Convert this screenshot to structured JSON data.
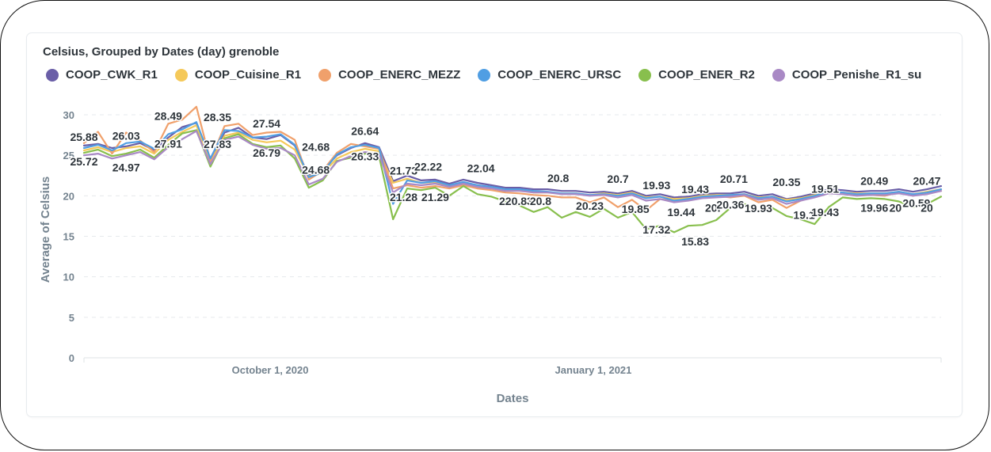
{
  "chart_data": {
    "type": "line",
    "title": "Celsius, Grouped by Dates (day) grenoble",
    "xlabel": "Dates",
    "ylabel": "Average of Celsius",
    "ylim": [
      0,
      30
    ],
    "yticks": [
      "0",
      "5",
      "10",
      "15",
      "20",
      "25",
      "30"
    ],
    "xticks": [
      {
        "date": "2020-10-01",
        "label": "October 1, 2020"
      },
      {
        "date": "2021-01-01",
        "label": "January 1, 2021"
      }
    ],
    "x_range": [
      "2020-08-09",
      "2021-04-10"
    ],
    "grid": true,
    "legend_position": "top-left",
    "x_dates": [
      "2020-08-09",
      "2020-08-13",
      "2020-08-17",
      "2020-08-21",
      "2020-08-25",
      "2020-08-29",
      "2020-09-02",
      "2020-09-06",
      "2020-09-10",
      "2020-09-14",
      "2020-09-18",
      "2020-09-22",
      "2020-09-26",
      "2020-09-30",
      "2020-10-04",
      "2020-10-08",
      "2020-10-12",
      "2020-10-16",
      "2020-10-20",
      "2020-10-24",
      "2020-10-28",
      "2020-11-01",
      "2020-11-05",
      "2020-11-09",
      "2020-11-13",
      "2020-11-17",
      "2020-11-21",
      "2020-11-25",
      "2020-11-29",
      "2020-12-03",
      "2020-12-07",
      "2020-12-11",
      "2020-12-15",
      "2020-12-19",
      "2020-12-23",
      "2020-12-27",
      "2020-12-31",
      "2021-01-04",
      "2021-01-08",
      "2021-01-12",
      "2021-01-16",
      "2021-01-20",
      "2021-01-24",
      "2021-01-28",
      "2021-02-01",
      "2021-02-05",
      "2021-02-09",
      "2021-02-13",
      "2021-02-17",
      "2021-02-21",
      "2021-02-25",
      "2021-03-01",
      "2021-03-05",
      "2021-03-09",
      "2021-03-13",
      "2021-03-17",
      "2021-03-21",
      "2021-03-25",
      "2021-03-29",
      "2021-04-02",
      "2021-04-06",
      "2021-04-10"
    ],
    "series": [
      {
        "name": "COOP_CWK_R1",
        "color": "#6a5ea7",
        "values": [
          26.2,
          26.4,
          25.9,
          26.1,
          26.5,
          25.6,
          27.2,
          28.5,
          29.0,
          24.5,
          27.8,
          28.4,
          27.2,
          27.0,
          27.5,
          26.2,
          22.5,
          23.2,
          25.0,
          25.9,
          26.5,
          26.0,
          21.8,
          22.5,
          21.9,
          22.0,
          21.5,
          22.0,
          21.6,
          21.3,
          21.0,
          21.0,
          20.8,
          20.8,
          20.6,
          20.6,
          20.4,
          20.5,
          20.3,
          20.6,
          20.0,
          20.2,
          19.8,
          19.9,
          20.2,
          20.3,
          20.3,
          20.5,
          20.0,
          20.2,
          19.6,
          19.9,
          20.3,
          20.8,
          20.7,
          20.5,
          20.6,
          20.6,
          20.8,
          20.5,
          20.8,
          21.2
        ]
      },
      {
        "name": "COOP_Cuisine_R1",
        "color": "#f5c95a",
        "values": [
          25.6,
          26.0,
          25.4,
          25.9,
          26.1,
          25.2,
          26.9,
          27.9,
          28.7,
          24.1,
          27.4,
          27.8,
          26.9,
          26.6,
          26.8,
          25.7,
          22.4,
          22.8,
          24.6,
          25.4,
          25.8,
          25.5,
          21.6,
          22.1,
          21.6,
          21.7,
          21.2,
          21.6,
          21.3,
          21.0,
          20.8,
          20.7,
          20.4,
          20.4,
          20.3,
          20.3,
          20.1,
          20.3,
          20.1,
          20.4,
          19.8,
          19.9,
          19.6,
          19.7,
          20.0,
          20.1,
          20.1,
          20.2,
          19.8,
          19.9,
          19.5,
          19.7,
          20.1,
          20.5,
          20.4,
          20.3,
          20.3,
          20.3,
          20.5,
          20.2,
          20.5,
          20.8
        ]
      },
      {
        "name": "COOP_ENERC_MEZZ",
        "color": "#f0a06b",
        "values": [
          26.5,
          27.9,
          25.2,
          27.8,
          26.8,
          25.4,
          28.9,
          29.4,
          31.0,
          24.3,
          28.6,
          28.9,
          27.5,
          27.8,
          27.9,
          26.9,
          22.0,
          23.1,
          25.3,
          26.4,
          26.1,
          25.8,
          20.9,
          21.3,
          21.0,
          21.2,
          20.9,
          21.3,
          20.9,
          20.7,
          20.4,
          20.3,
          20.1,
          20.0,
          19.8,
          19.8,
          19.2,
          19.8,
          18.6,
          19.5,
          18.2,
          19.6,
          19.3,
          19.5,
          19.9,
          20.0,
          19.8,
          20.0,
          19.2,
          19.5,
          18.5,
          19.4,
          19.9,
          20.6,
          20.4,
          20.1,
          20.1,
          20.0,
          20.4,
          20.0,
          20.3,
          20.6
        ]
      },
      {
        "name": "COOP_ENERC_URSC",
        "color": "#509ee3",
        "values": [
          25.9,
          26.3,
          25.6,
          26.5,
          26.7,
          25.8,
          27.6,
          28.2,
          29.1,
          24.6,
          28.1,
          28.0,
          27.2,
          27.3,
          27.6,
          26.3,
          22.3,
          22.9,
          25.1,
          26.0,
          26.3,
          25.9,
          19.0,
          21.9,
          21.6,
          21.8,
          21.3,
          21.7,
          21.3,
          21.1,
          20.8,
          20.8,
          20.6,
          20.5,
          20.3,
          20.3,
          20.1,
          20.2,
          20.0,
          20.3,
          19.7,
          19.9,
          19.4,
          19.6,
          19.9,
          20.0,
          20.1,
          20.2,
          19.7,
          19.9,
          19.3,
          19.6,
          20.0,
          20.5,
          20.4,
          20.2,
          20.3,
          20.3,
          20.5,
          20.2,
          20.4,
          20.8
        ]
      },
      {
        "name": "COOP_ENER_R2",
        "color": "#88bf4d",
        "values": [
          25.3,
          25.7,
          24.9,
          25.2,
          25.7,
          24.7,
          26.3,
          27.7,
          28.1,
          23.6,
          27.1,
          27.6,
          26.4,
          26.0,
          26.2,
          24.6,
          21.0,
          21.9,
          24.3,
          24.7,
          25.2,
          24.9,
          17.1,
          20.9,
          20.7,
          21.0,
          20.0,
          21.2,
          20.2,
          19.9,
          19.3,
          18.8,
          18.0,
          18.6,
          17.3,
          18.0,
          17.4,
          18.4,
          17.3,
          18.0,
          15.9,
          16.3,
          15.5,
          16.3,
          16.4,
          17.0,
          18.5,
          19.0,
          18.1,
          18.5,
          17.5,
          17.1,
          16.5,
          18.6,
          19.8,
          19.6,
          19.7,
          19.6,
          19.3,
          18.6,
          19.0,
          19.9
        ]
      },
      {
        "name": "COOP_Penishe_R1_su",
        "color": "#a989c5",
        "values": [
          25.0,
          25.2,
          24.6,
          25.0,
          25.4,
          24.5,
          26.0,
          27.0,
          28.0,
          23.9,
          26.9,
          27.3,
          26.3,
          25.8,
          25.9,
          25.0,
          21.4,
          22.1,
          24.2,
          24.9,
          25.4,
          25.1,
          20.4,
          21.5,
          21.3,
          21.5,
          21.1,
          21.5,
          21.1,
          20.9,
          20.6,
          20.6,
          20.4,
          20.4,
          20.2,
          20.2,
          20.0,
          20.1,
          19.8,
          20.1,
          19.4,
          19.6,
          19.2,
          19.4,
          19.7,
          19.8,
          19.9,
          20.1,
          19.5,
          19.7,
          19.0,
          19.4,
          19.8,
          20.3,
          20.2,
          20.0,
          20.1,
          20.1,
          20.3,
          20.0,
          20.2,
          20.6
        ]
      }
    ],
    "data_labels": [
      {
        "date": "2020-08-09",
        "value": 25.88,
        "text": "25.88",
        "pos": "above"
      },
      {
        "date": "2020-08-09",
        "value": 25.72,
        "text": "25.72",
        "pos": "below"
      },
      {
        "date": "2020-08-21",
        "value": 26.03,
        "text": "26.03",
        "pos": "above"
      },
      {
        "date": "2020-08-21",
        "value": 24.97,
        "text": "24.97",
        "pos": "below"
      },
      {
        "date": "2020-09-02",
        "value": 28.49,
        "text": "28.49",
        "pos": "above"
      },
      {
        "date": "2020-09-02",
        "value": 27.91,
        "text": "27.91",
        "pos": "below"
      },
      {
        "date": "2020-09-16",
        "value": 28.35,
        "text": "28.35",
        "pos": "above"
      },
      {
        "date": "2020-09-16",
        "value": 27.83,
        "text": "27.83",
        "pos": "below"
      },
      {
        "date": "2020-09-30",
        "value": 27.54,
        "text": "27.54",
        "pos": "above"
      },
      {
        "date": "2020-09-30",
        "value": 26.79,
        "text": "26.79",
        "pos": "below"
      },
      {
        "date": "2020-10-14",
        "value": 24.68,
        "text": "24.68",
        "pos": "above"
      },
      {
        "date": "2020-10-14",
        "value": 24.68,
        "text": "24.68",
        "pos": "below"
      },
      {
        "date": "2020-10-28",
        "value": 26.64,
        "text": "26.64",
        "pos": "above"
      },
      {
        "date": "2020-10-28",
        "value": 26.33,
        "text": "26.33",
        "pos": "below"
      },
      {
        "date": "2020-11-08",
        "value": 21.73,
        "text": "21.73",
        "pos": "above"
      },
      {
        "date": "2020-11-08",
        "value": 21.28,
        "text": "21.28",
        "pos": "below"
      },
      {
        "date": "2020-11-15",
        "value": 22.22,
        "text": "22.22",
        "pos": "above"
      },
      {
        "date": "2020-11-17",
        "value": 21.29,
        "text": "21.29",
        "pos": "below"
      },
      {
        "date": "2020-11-30",
        "value": 22.04,
        "text": "22.04",
        "pos": "above"
      },
      {
        "date": "2020-12-10",
        "value": 20.83,
        "text": "220.83",
        "pos": "below"
      },
      {
        "date": "2020-12-17",
        "value": 20.8,
        "text": "20.8",
        "pos": "below"
      },
      {
        "date": "2020-12-22",
        "value": 20.8,
        "text": "20.8",
        "pos": "above"
      },
      {
        "date": "2020-12-31",
        "value": 20.23,
        "text": "20.23",
        "pos": "below"
      },
      {
        "date": "2021-01-08",
        "value": 20.7,
        "text": "20.7",
        "pos": "above"
      },
      {
        "date": "2021-01-13",
        "value": 19.85,
        "text": "19.85",
        "pos": "below"
      },
      {
        "date": "2021-01-19",
        "value": 19.93,
        "text": "19.93",
        "pos": "above"
      },
      {
        "date": "2021-01-19",
        "value": 17.32,
        "text": "17.32",
        "pos": "below"
      },
      {
        "date": "2021-01-26",
        "value": 19.44,
        "text": "19.44",
        "pos": "below"
      },
      {
        "date": "2021-01-30",
        "value": 19.43,
        "text": "19.43",
        "pos": "above"
      },
      {
        "date": "2021-01-30",
        "value": 15.83,
        "text": "15.83",
        "pos": "below"
      },
      {
        "date": "2021-02-04",
        "value": 20.0,
        "text": "20.",
        "pos": "below"
      },
      {
        "date": "2021-02-09",
        "value": 20.36,
        "text": "20.36",
        "pos": "below"
      },
      {
        "date": "2021-02-10",
        "value": 20.71,
        "text": "20.71",
        "pos": "above"
      },
      {
        "date": "2021-02-17",
        "value": 19.93,
        "text": "19.93",
        "pos": "below"
      },
      {
        "date": "2021-02-25",
        "value": 20.35,
        "text": "20.35",
        "pos": "above"
      },
      {
        "date": "2021-03-02",
        "value": 19.1,
        "text": "19.1",
        "pos": "below"
      },
      {
        "date": "2021-03-08",
        "value": 19.43,
        "text": "19.43",
        "pos": "below"
      },
      {
        "date": "2021-03-08",
        "value": 19.51,
        "text": "19.51",
        "pos": "above"
      },
      {
        "date": "2021-03-22",
        "value": 20.49,
        "text": "20.49",
        "pos": "above"
      },
      {
        "date": "2021-03-22",
        "value": 19.96,
        "text": "19.96",
        "pos": "below"
      },
      {
        "date": "2021-03-28",
        "value": 20.0,
        "text": "20",
        "pos": "below"
      },
      {
        "date": "2021-04-03",
        "value": 20.59,
        "text": "20.59",
        "pos": "below"
      },
      {
        "date": "2021-04-18",
        "value": 20.47,
        "text": "20.47",
        "pos": "above"
      },
      {
        "date": "2021-04-18",
        "value": 20.0,
        "text": "20",
        "pos": "below"
      }
    ]
  }
}
